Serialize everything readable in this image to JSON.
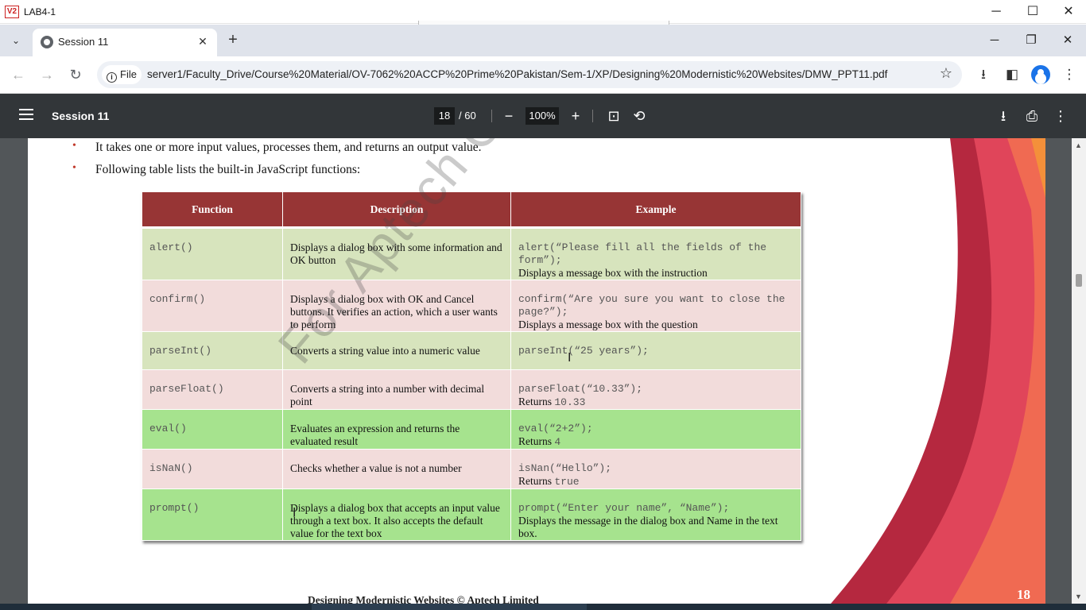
{
  "vm_window": {
    "logo": "V2",
    "title": "LAB4-1",
    "minimize": "─",
    "maximize": "☐",
    "close": "✕"
  },
  "browser": {
    "tab_title": "Session 11",
    "tab_close": "✕",
    "new_tab": "+",
    "tab_list": "⌄",
    "minimize": "─",
    "restore": "❐",
    "close": "✕",
    "back": "←",
    "forward": "→",
    "reload": "↻",
    "site_chip": "File",
    "url": "server1/Faculty_Drive/Course%20Material/OV-7062%20ACCP%20Prime%20Pakistan/Sem-1/XP/Designing%20Modernistic%20Websites/DMW_PPT11.pdf",
    "bookmark": "☆",
    "download": "⭳",
    "sidepanel": "◧",
    "menu": "⋮"
  },
  "pdf_viewer": {
    "title": "Session 11",
    "current_page": "18",
    "total_pages": "/ 60",
    "zoom_out": "−",
    "zoom_level": "100%",
    "zoom_in": "+",
    "fit": "⊡",
    "rotate": "⟲",
    "download": "⭳",
    "print": "⎙",
    "more": "⋮"
  },
  "slide": {
    "bullets": [
      "It takes one or more input values, processes them, and returns an output value.",
      "Following table lists the built-in JavaScript functions:"
    ],
    "table": {
      "headers": [
        "Function",
        "Description",
        "Example"
      ],
      "rows": [
        {
          "function": "alert()",
          "description": "Displays a dialog box with some information and OK button",
          "code": "alert(“Please fill all the fields of the form”);",
          "note": "Displays a message box with the instruction",
          "note_value": ""
        },
        {
          "function": "confirm()",
          "description": "Displays a dialog box with OK and Cancel buttons. It verifies an action, which a user wants to perform",
          "code": "confirm(“Are you sure you want to close the page?”);",
          "note": "Displays a message box with the question",
          "note_value": ""
        },
        {
          "function": "parseInt()",
          "description": "Converts a string value into a numeric value",
          "code": "parseInt(“25 years”);",
          "note": "",
          "note_value": ""
        },
        {
          "function": "parseFloat()",
          "description": "Converts a string into a number with decimal point",
          "code": "parseFloat(“10.33”);",
          "note": "Returns ",
          "note_value": "10.33"
        },
        {
          "function": "eval()",
          "description": "Evaluates an expression and returns the evaluated result",
          "code": "eval(“2+2”);",
          "note": "Returns ",
          "note_value": "4"
        },
        {
          "function": "isNaN()",
          "description": "Checks whether a value is not a number",
          "code": "isNan(“Hello”);",
          "note": "Returns ",
          "note_value": "true"
        },
        {
          "function": "prompt()",
          "description": "Displays a dialog box that accepts an input value through a text box. It also accepts the default value for the text box",
          "code": "prompt(“Enter your name”, “Name”);",
          "note": "Displays the message in the dialog box and Name in the text box.",
          "note_value": ""
        }
      ]
    },
    "watermark": "For Aptech Centre Use Only",
    "footer": "Designing Modernistic Websites © Aptech Limited",
    "slide_number": "18"
  },
  "scrollbar": {
    "up": "▲",
    "down": "▼"
  },
  "colors": {
    "header_red": "#973535",
    "row_green": "#d7e4bd",
    "row_pink": "#f2dcdb",
    "row_bright_green": "#a6e38e",
    "pdf_toolbar": "#323639"
  }
}
